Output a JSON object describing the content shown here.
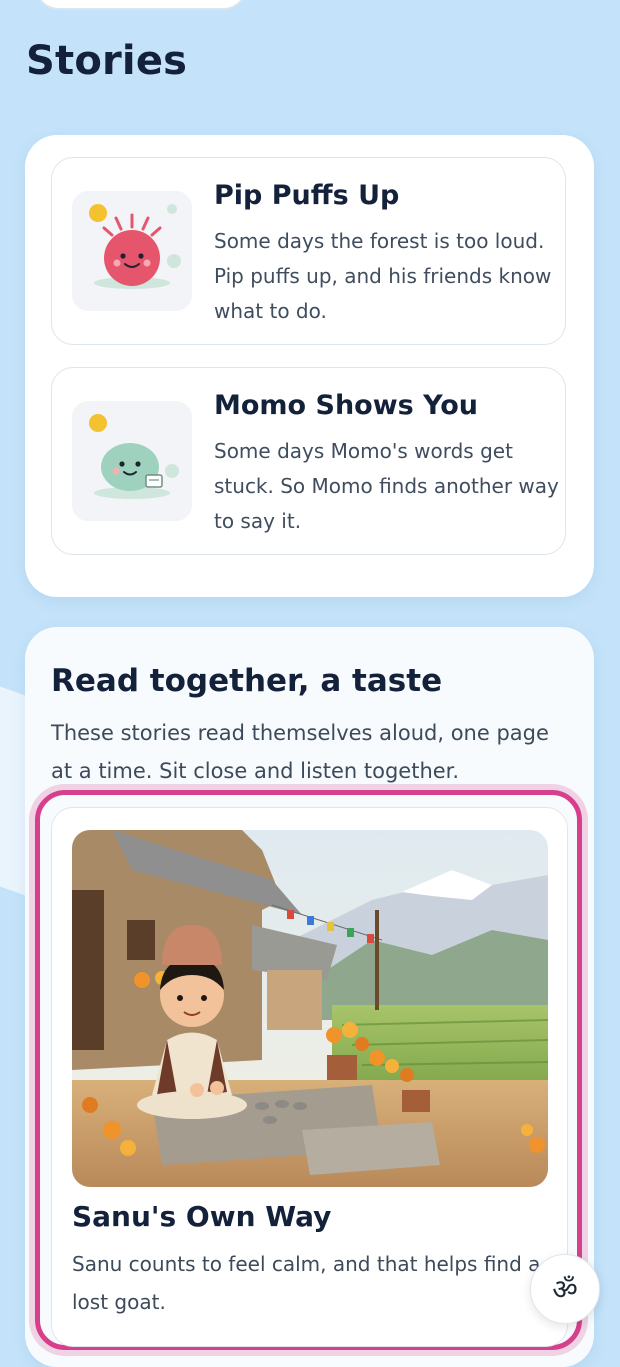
{
  "page": {
    "title": "Stories"
  },
  "stories": [
    {
      "title": "Pip Puffs Up",
      "description": "Some days the forest is too loud. Pip puffs up, and his friends know what to do.",
      "icon": "pink-puffball-illustration",
      "color": "#e5566c"
    },
    {
      "title": "Momo Shows You",
      "description": "Some days Momo's words get stuck. So Momo finds another way to say it.",
      "icon": "green-blob-illustration",
      "color": "#9fd1bf"
    }
  ],
  "read_together": {
    "heading": "Read together, a taste",
    "subtitle": "These stories read themselves aloud, one page at a time. Sit close and listen together.",
    "featured": {
      "title": "Sanu's Own Way",
      "description": "Sanu counts to feel calm, and that helps find a lost goat.",
      "image": "boy-sitting-by-mountain-village-illustration"
    }
  },
  "language_button": {
    "label": "ॐ",
    "icon": "language-icon"
  },
  "colors": {
    "background": "#c4e3fa",
    "focus_ring": "#d63f8c",
    "heading": "#14213a"
  }
}
